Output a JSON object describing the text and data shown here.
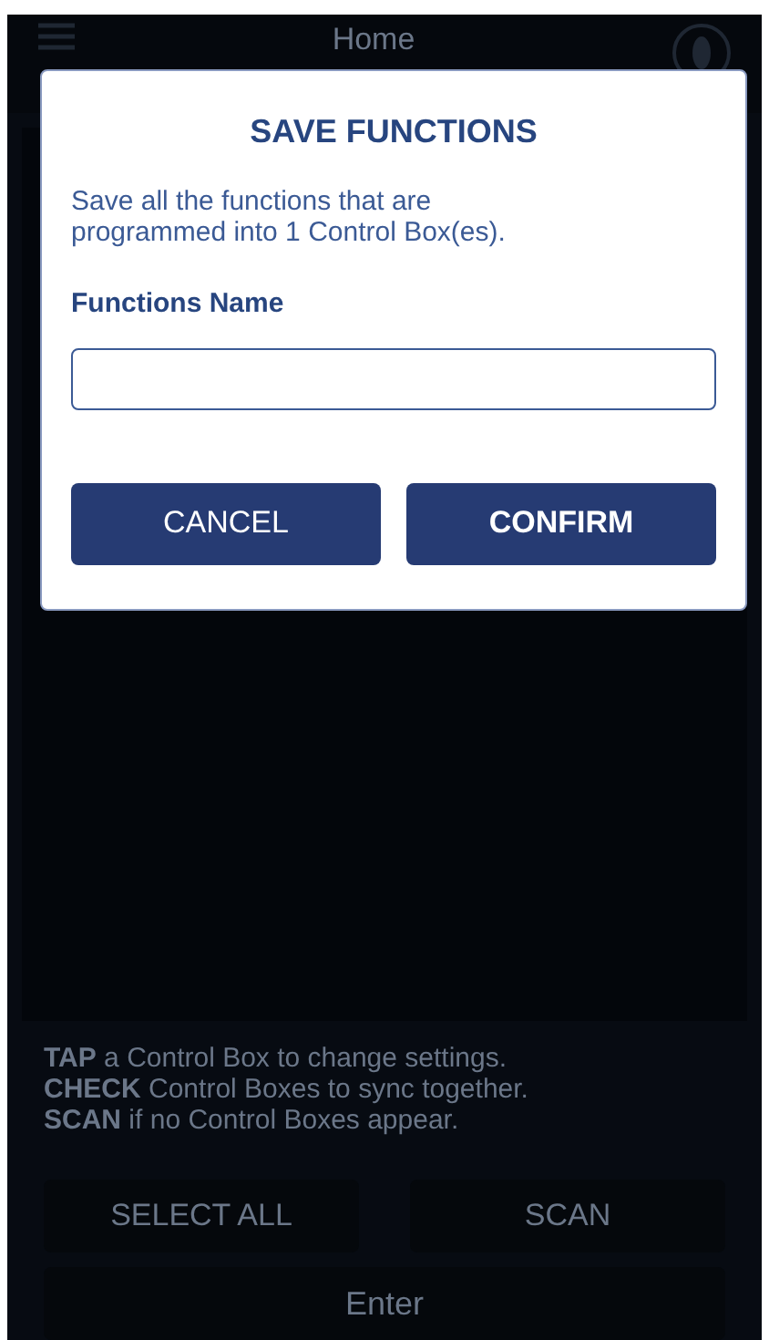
{
  "header": {
    "title": "Home"
  },
  "dialog": {
    "title": "SAVE FUNCTIONS",
    "message": "Save all the functions that are programmed into 1 Control Box(es).",
    "field_label": "Functions Name",
    "buttons": [
      {
        "label": "CANCEL",
        "bold": false
      },
      {
        "label": "CONFIRM",
        "bold": true
      }
    ]
  },
  "instructions": [
    "**TAP** a Control Box to change settings.",
    "**CHECK** Control Boxes to sync together.",
    "**SCAN** if no Control Boxes appear."
  ],
  "buttons": [
    "SELECT ALL",
    "SCAN"
  ],
  "enter_button": "Enter"
}
